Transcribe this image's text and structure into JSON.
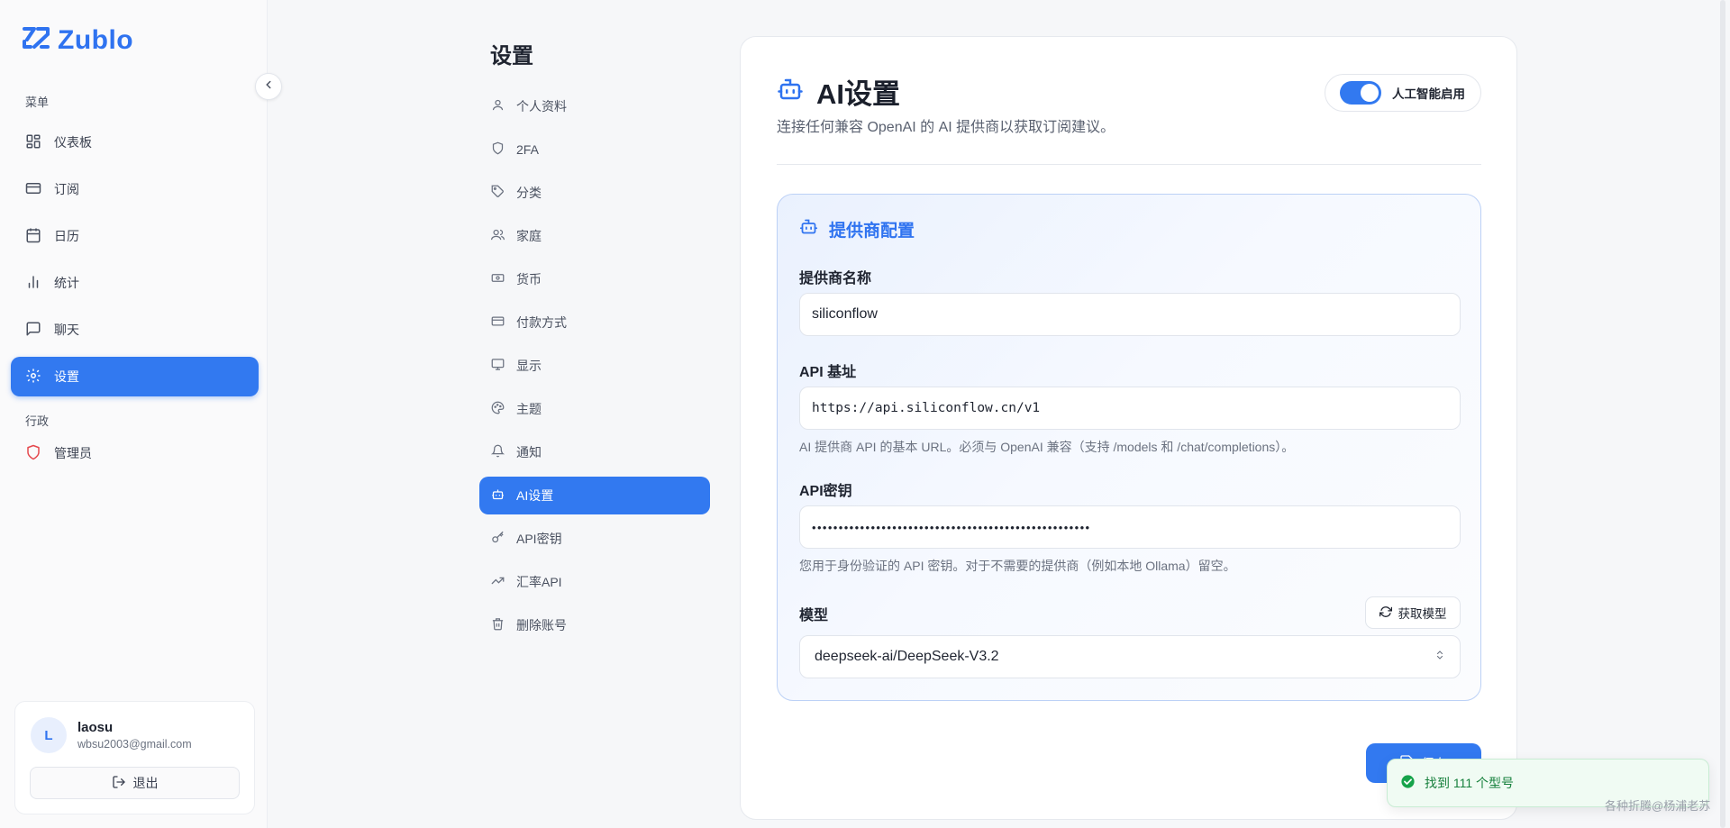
{
  "app": {
    "name": "Zublo"
  },
  "sidebar": {
    "menu_label": "菜单",
    "items": [
      {
        "label": "仪表板",
        "icon": "dashboard-icon"
      },
      {
        "label": "订阅",
        "icon": "card-icon"
      },
      {
        "label": "日历",
        "icon": "calendar-icon"
      },
      {
        "label": "统计",
        "icon": "bar-chart-icon"
      },
      {
        "label": "聊天",
        "icon": "chat-icon"
      },
      {
        "label": "设置",
        "icon": "gear-icon",
        "active": true
      }
    ],
    "admin_label": "行政",
    "admin_items": [
      {
        "label": "管理员",
        "icon": "shield-icon",
        "color": "#e5484d"
      }
    ],
    "user": {
      "initial": "L",
      "name": "laosu",
      "email": "wbsu2003@gmail.com",
      "logout_label": "退出"
    }
  },
  "settings_menu": {
    "title": "设置",
    "items": [
      {
        "label": "个人资料",
        "icon": "user-icon"
      },
      {
        "label": "2FA",
        "icon": "shield-icon"
      },
      {
        "label": "分类",
        "icon": "tag-icon"
      },
      {
        "label": "家庭",
        "icon": "users-icon"
      },
      {
        "label": "货币",
        "icon": "banknote-icon"
      },
      {
        "label": "付款方式",
        "icon": "card-icon"
      },
      {
        "label": "显示",
        "icon": "monitor-icon"
      },
      {
        "label": "主题",
        "icon": "palette-icon"
      },
      {
        "label": "通知",
        "icon": "bell-icon"
      },
      {
        "label": "AI设置",
        "icon": "bot-icon",
        "active": true
      },
      {
        "label": "API密钥",
        "icon": "key-icon"
      },
      {
        "label": "汇率API",
        "icon": "trending-icon"
      },
      {
        "label": "删除账号",
        "icon": "trash-icon"
      }
    ]
  },
  "main": {
    "title": "AI设置",
    "subtitle": "连接任何兼容 OpenAI 的 AI 提供商以获取订阅建议。",
    "ai_toggle": {
      "label": "人工智能启用",
      "enabled": true
    },
    "provider": {
      "title": "提供商配置",
      "name_label": "提供商名称",
      "name_value": "siliconflow",
      "base_label": "API 基址",
      "base_value": "https://api.siliconflow.cn/v1",
      "base_help": "AI 提供商 API 的基本 URL。必须与 OpenAI 兼容（支持 /models 和 /chat/completions）。",
      "key_label": "API密钥",
      "key_value": "••••••••••••••••••••••••••••••••••••••••••••••••••••",
      "key_help": "您用于身份验证的 API 密钥。对于不需要的提供商（例如本地 Ollama）留空。",
      "model_label": "模型",
      "fetch_label": "获取模型",
      "model_value": "deepseek-ai/DeepSeek-V3.2"
    },
    "save_label": "保存"
  },
  "toast": {
    "message": "找到 111 个型号"
  },
  "watermark": "各种折腾@杨浦老苏",
  "colors": {
    "accent": "#3279f0",
    "success": "#16803c",
    "danger": "#e5484d"
  }
}
